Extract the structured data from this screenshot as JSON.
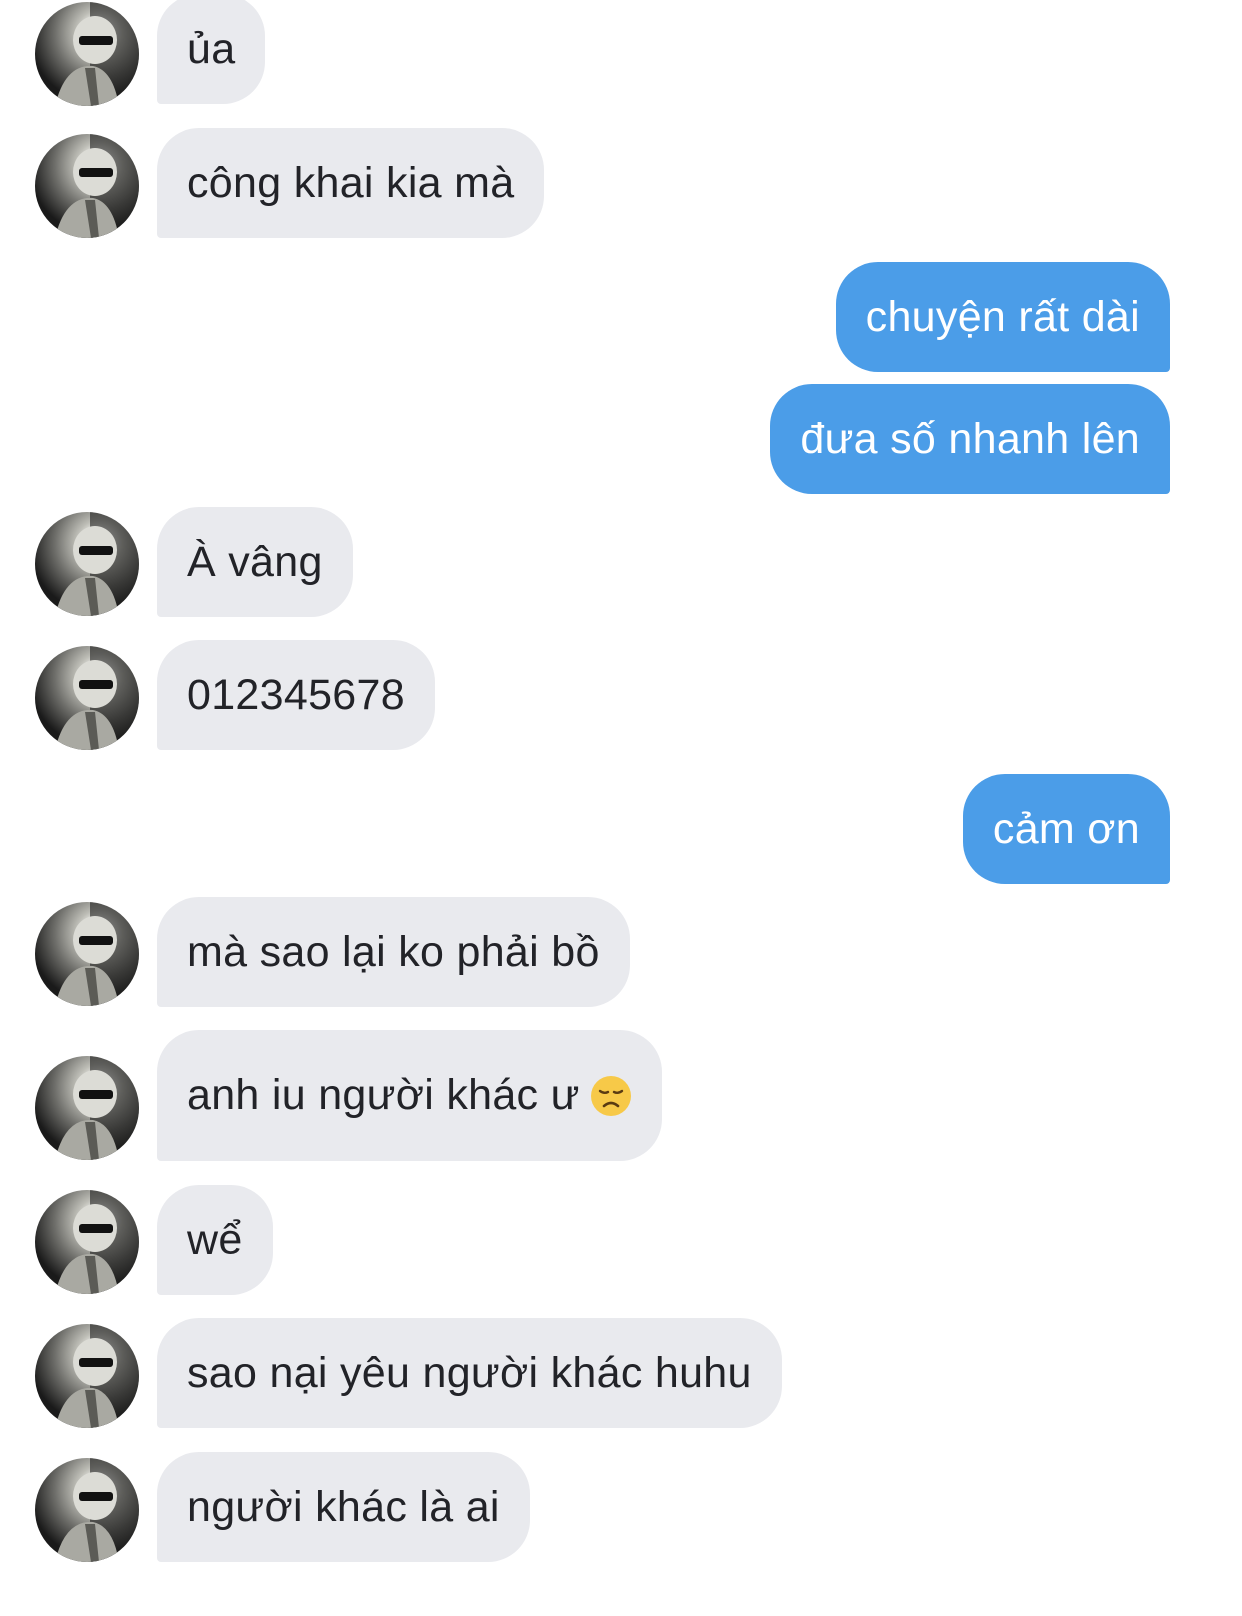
{
  "messages": [
    {
      "from": "other",
      "text": "ủa"
    },
    {
      "from": "other",
      "text": "công khai kia mà"
    },
    {
      "from": "me",
      "text": "chuyện rất dài"
    },
    {
      "from": "me",
      "text": "đưa số nhanh lên"
    },
    {
      "from": "other",
      "text": "À vâng"
    },
    {
      "from": "other",
      "text": "012345678"
    },
    {
      "from": "me",
      "text": "cảm ơn"
    },
    {
      "from": "other",
      "text": "mà sao lại ko phải bồ"
    },
    {
      "from": "other",
      "text": "anh iu người khác ư",
      "emoji": "disappointed-face-emoji"
    },
    {
      "from": "other",
      "text": "wể"
    },
    {
      "from": "other",
      "text": "sao nại yêu người khác huhu"
    },
    {
      "from": "other",
      "text": "người khác là ai"
    }
  ],
  "colors": {
    "incoming_bubble": "#e9eaee",
    "outgoing_bubble": "#4b9de8",
    "incoming_text": "#222328",
    "outgoing_text": "#ffffff",
    "background": "#ffffff"
  }
}
